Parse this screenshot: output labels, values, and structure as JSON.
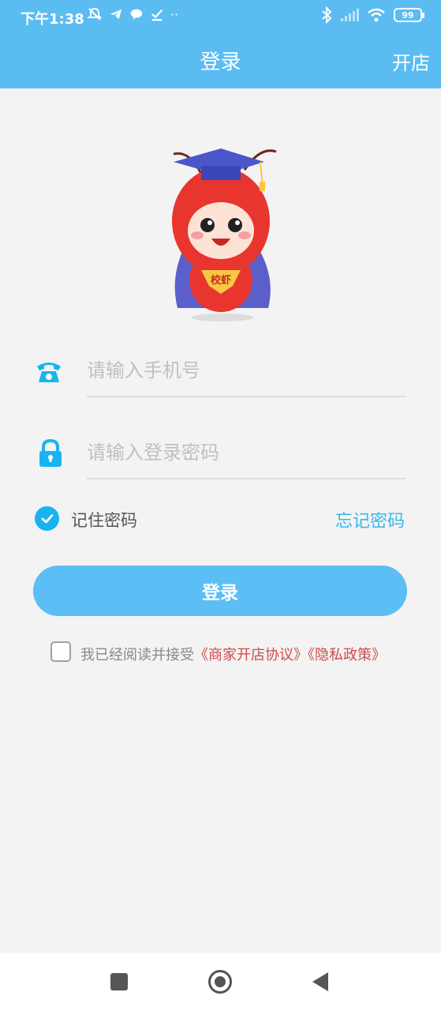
{
  "status_bar": {
    "time": "下午1:38",
    "battery": "99"
  },
  "nav": {
    "title": "登录",
    "right_label": "开店"
  },
  "mascot": {
    "badge_text": "校虾"
  },
  "form": {
    "phone_placeholder": "请输入手机号",
    "password_placeholder": "请输入登录密码",
    "remember_label": "记住密码",
    "forgot_label": "忘记密码",
    "login_label": "登录"
  },
  "agreement": {
    "prefix": "我已经阅读并接受",
    "merchant_policy": "《商家开店协议》",
    "privacy_policy": "《隐私政策》"
  },
  "colors": {
    "accent": "#5bbcf2",
    "link": "#38b6ef",
    "policy": "#d14a4a"
  },
  "icons": {
    "phone": "telephone-icon",
    "password": "lock-icon",
    "remember": "check-circle-icon"
  }
}
